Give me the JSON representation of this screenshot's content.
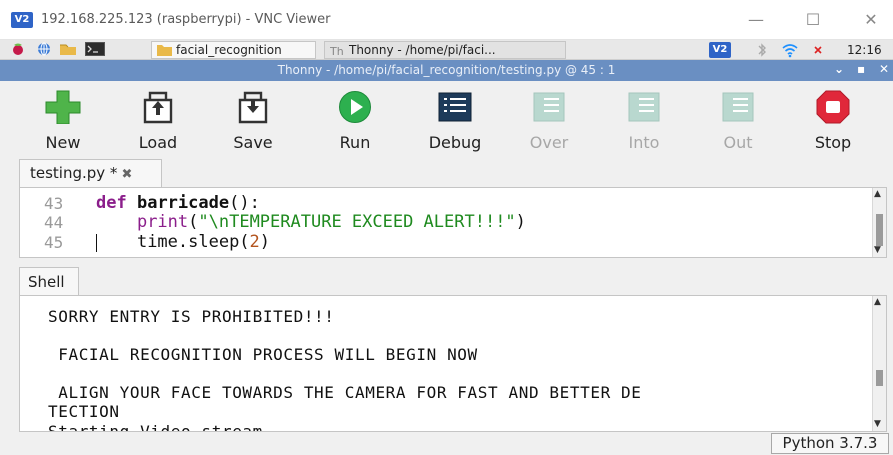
{
  "vnc": {
    "logo": "V2",
    "title": "192.168.225.123 (raspberrypi) - VNC Viewer",
    "minimize": "—",
    "maximize": "☐",
    "close": "✕"
  },
  "panel": {
    "task_folder": "facial_recognition",
    "task_thonny": "Thonny - /home/pi/faci...",
    "tray_vnc": "V2",
    "clock": "12:16"
  },
  "thonny": {
    "title": "Thonny - /home/pi/facial_recognition/testing.py @ 45 : 1"
  },
  "toolbar": {
    "new": "New",
    "load": "Load",
    "save": "Save",
    "run": "Run",
    "debug": "Debug",
    "over": "Over",
    "into": "Into",
    "out": "Out",
    "stop": "Stop"
  },
  "editor": {
    "tab_label": "testing.py *",
    "tab_close": "✖",
    "lines": [
      {
        "number": "43",
        "kw": "def",
        "fn": "barricade",
        "rest": "():"
      },
      {
        "number": "44",
        "indent": "    ",
        "bi": "print",
        "open": "(",
        "str": "\"\\nTEMPERATURE EXCEED ALERT!!!\"",
        "close": ")"
      },
      {
        "number": "45",
        "indent": "    ",
        "pre": "time.sleep(",
        "num": "2",
        "close": ")"
      }
    ]
  },
  "shell": {
    "tab_label": "Shell",
    "lines": [
      "SORRY ENTRY IS PROHIBITED!!!",
      " FACIAL RECOGNITION PROCESS WILL BEGIN NOW",
      " ALIGN YOUR FACE TOWARDS THE CAMERA FOR FAST AND BETTER DE",
      "TECTION",
      "Starting Video stream..."
    ]
  },
  "status": {
    "interpreter": "Python 3.7.3"
  }
}
